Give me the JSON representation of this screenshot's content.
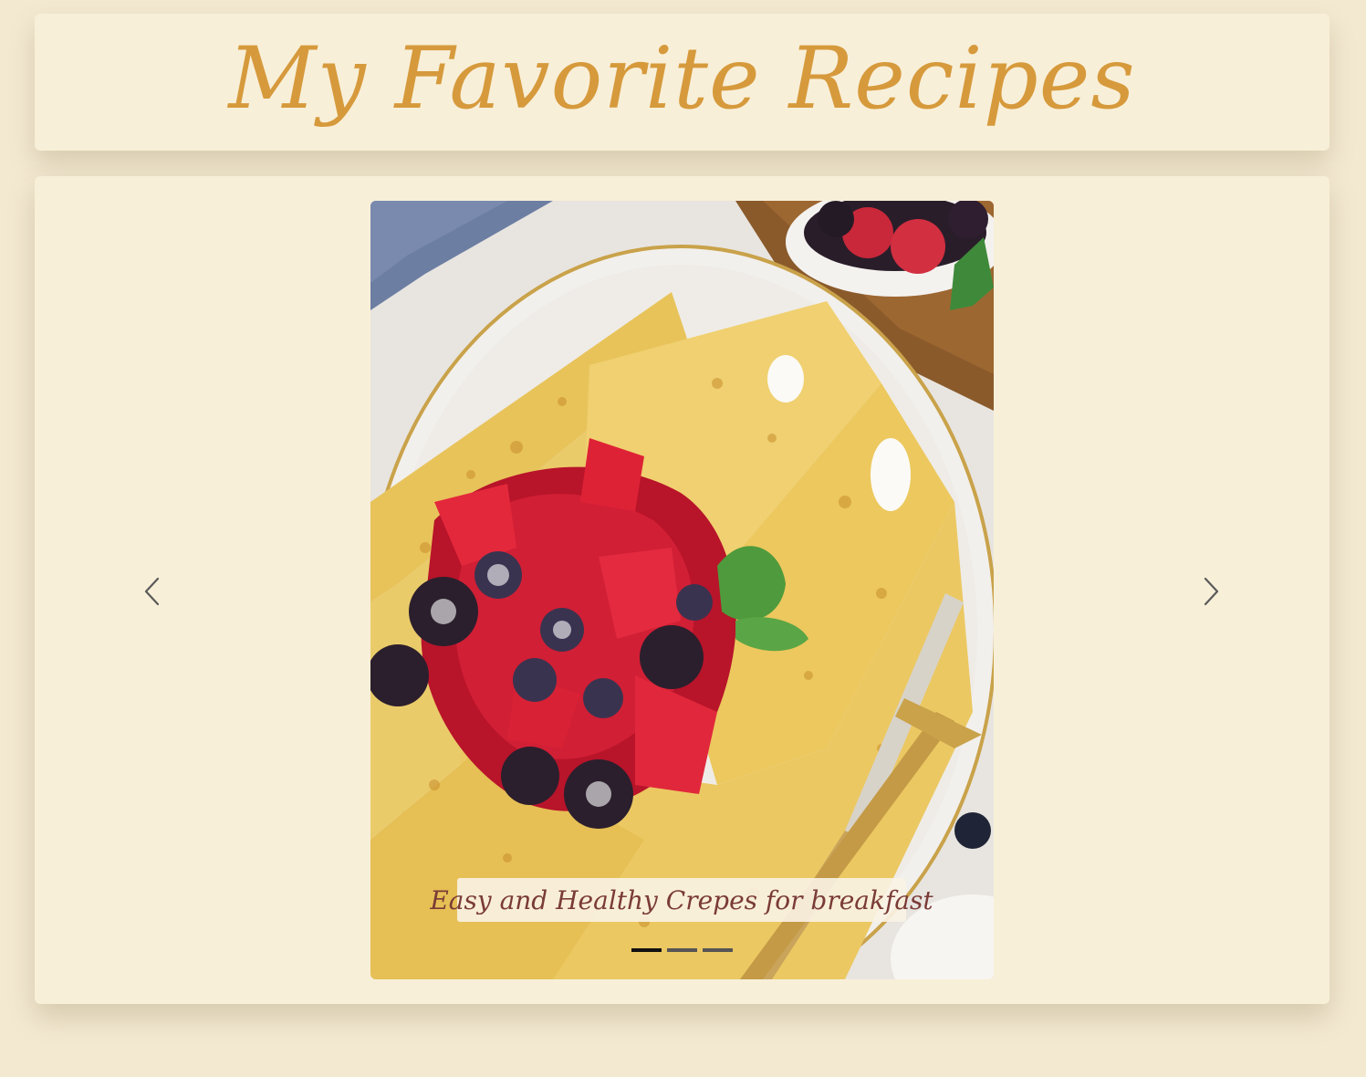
{
  "header": {
    "title": "My Favorite Recipes"
  },
  "carousel": {
    "caption": "Easy and Healthy Crepes for breakfast",
    "slide_count": 3,
    "active_slide": 1,
    "prev_icon": "chevron-left-icon",
    "next_icon": "chevron-right-icon"
  },
  "colors": {
    "page_background": "#f3e9d1",
    "card_background": "#f8efd8",
    "title": "#d69a3c",
    "caption_text": "#7a3b36",
    "indicator_active": "#111111",
    "indicator_inactive": "#555555"
  }
}
